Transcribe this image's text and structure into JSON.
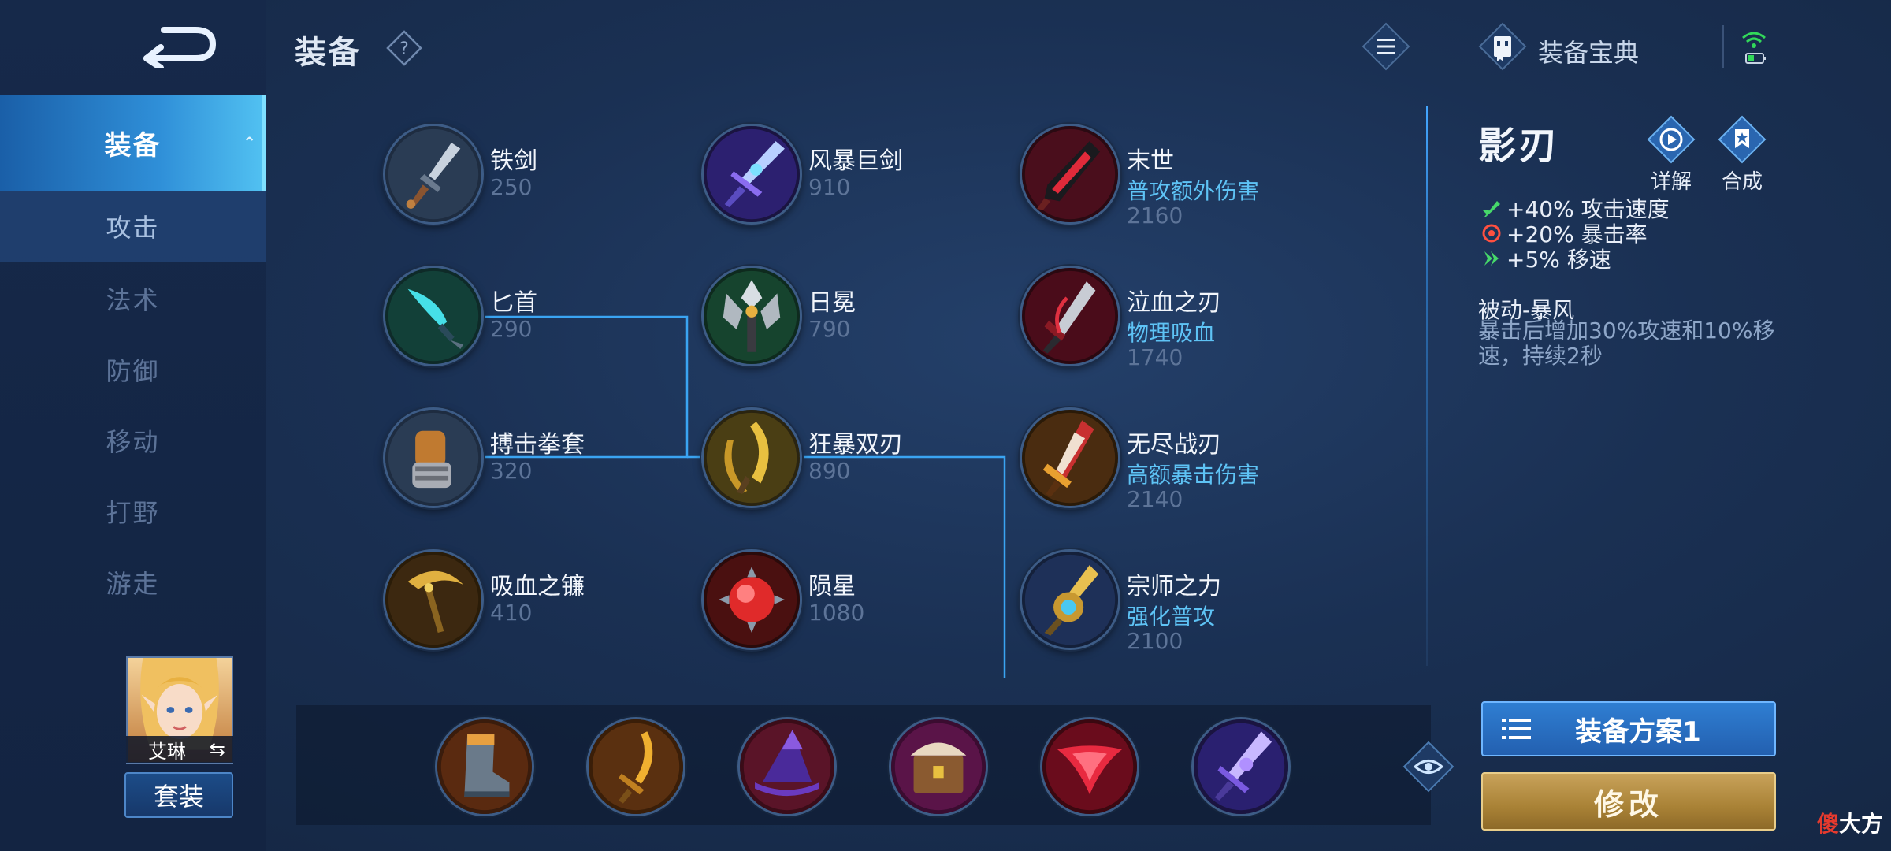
{
  "header": {
    "title": "装备",
    "codex_label": "装备宝典"
  },
  "sidebar": {
    "categories": [
      {
        "label": "装备",
        "active": true
      },
      {
        "label": "攻击"
      },
      {
        "label": "法术"
      },
      {
        "label": "防御"
      },
      {
        "label": "移动"
      },
      {
        "label": "打野"
      },
      {
        "label": "游走"
      }
    ],
    "hero_name": "艾琳",
    "hero_swap_icon": "⇆",
    "suit_label": "套装"
  },
  "items": [
    {
      "name": "铁剑",
      "price": "250"
    },
    {
      "name": "风暴巨剑",
      "price": "910"
    },
    {
      "name": "末世",
      "desc": "普攻额外伤害",
      "price": "2160"
    },
    {
      "name": "匕首",
      "price": "290"
    },
    {
      "name": "日冕",
      "price": "790"
    },
    {
      "name": "泣血之刃",
      "desc": "物理吸血",
      "price": "1740"
    },
    {
      "name": "搏击拳套",
      "price": "320"
    },
    {
      "name": "狂暴双刃",
      "price": "890"
    },
    {
      "name": "无尽战刃",
      "desc": "高额暴击伤害",
      "price": "2140"
    },
    {
      "name": "吸血之镰",
      "price": "410"
    },
    {
      "name": "陨星",
      "price": "1080"
    },
    {
      "name": "宗师之力",
      "desc": "强化普攻",
      "price": "2100"
    }
  ],
  "detail": {
    "name": "影刃",
    "detail_label": "详解",
    "compose_label": "合成",
    "stats": [
      "+40% 攻击速度",
      "+20% 暴击率",
      "+5% 移速"
    ],
    "passive_title": "被动-暴风",
    "passive_desc": "暴击后增加30%攻速和10%移速，持续2秒"
  },
  "plan": {
    "label": "装备方案1",
    "edit_label": "修改"
  },
  "watermark": {
    "red": "傻",
    "white": "大方"
  },
  "icons": {
    "back": "back-arrow-icon",
    "help": "question-icon",
    "menu": "list-menu-icon",
    "codex": "codex-book-icon",
    "wifi": "wifi-icon",
    "eye": "eye-icon",
    "detail": "play-circle-icon",
    "compose": "compose-star-icon"
  },
  "colors": {
    "accent": "#2f8fd8",
    "desc_blue": "#5ec3f5",
    "price_gray": "#5d7498",
    "gold_button": "#b38c40"
  }
}
